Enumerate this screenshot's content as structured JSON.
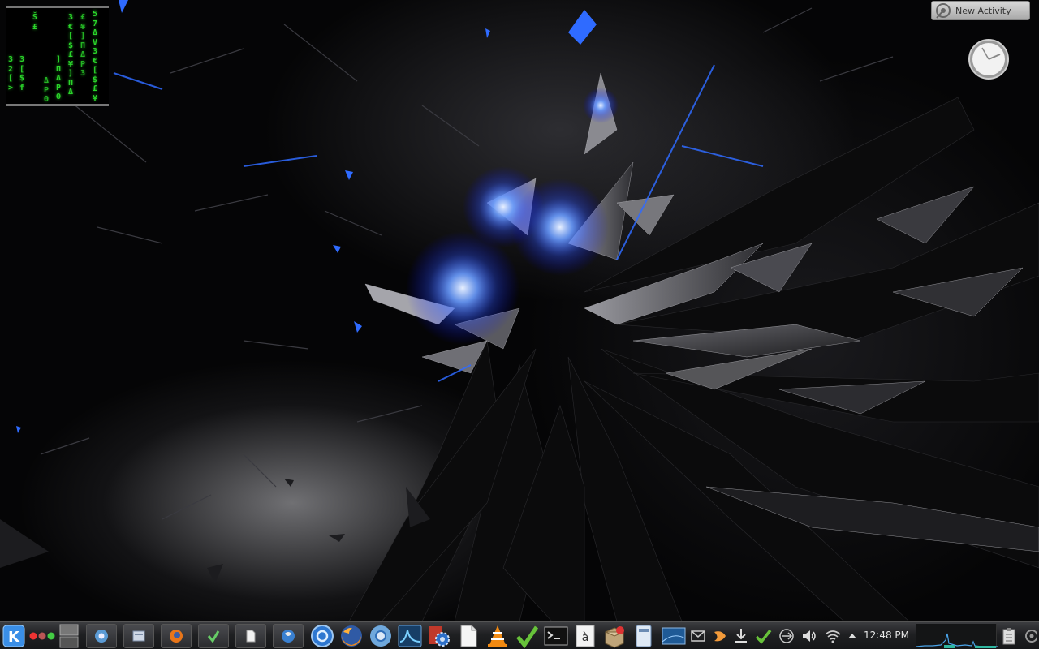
{
  "matrix_widget": {
    "columns": [
      "",
      "3\n2\n[\n>",
      "3\n[\n$\nf",
      "Š\n£",
      "Δ\nP\nΘ",
      "]\nΠ\nΔ\nP\nΘ",
      "3\n€\n[\n$\n£\n¥\n]\nΠ\nΔ",
      "£\n¥\n]\nΠ\nΔ\nP\n3",
      "5\n7\nΔ\nV\n3\n€\n[\n$\n£\n¥"
    ]
  },
  "activity_button": {
    "label": "New Activity"
  },
  "taskbar": {
    "clock": "12:48 PM"
  },
  "colors": {
    "matrix_green": "#2bd42b",
    "accent_blue": "#3a7bff",
    "panel_dark": "#1f2022"
  }
}
